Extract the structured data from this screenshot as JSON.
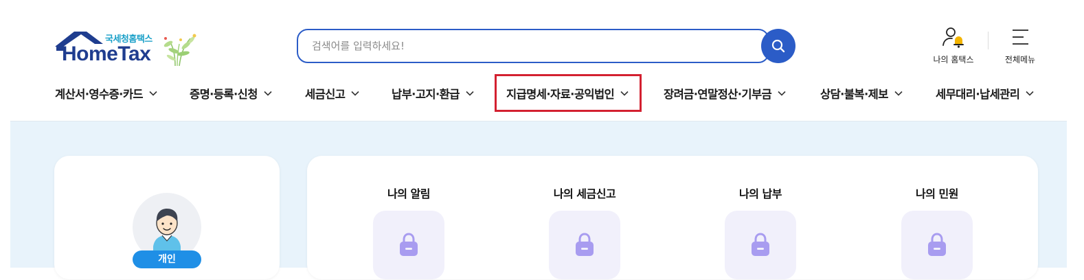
{
  "logo": {
    "sub": "국세청홈택스",
    "main": "HomeTax"
  },
  "search": {
    "placeholder": "검색어를 입력하세요!",
    "value": ""
  },
  "utils": {
    "my_hometax": "나의 홈택스",
    "all_menu": "전체메뉴"
  },
  "gnb": [
    {
      "label": "계산서·영수증·카드"
    },
    {
      "label": "증명·등록·신청"
    },
    {
      "label": "세금신고"
    },
    {
      "label": "납부·고지·환급"
    },
    {
      "label": "지급명세·자료·공익법인"
    },
    {
      "label": "장려금·연말정산·기부금"
    },
    {
      "label": "상담·불복·제보"
    },
    {
      "label": "세무대리·납세관리"
    }
  ],
  "profile": {
    "user_type": "개인"
  },
  "my_services": [
    {
      "title": "나의 알림",
      "icon": "lock-icon"
    },
    {
      "title": "나의 세금신고",
      "icon": "lock-icon"
    },
    {
      "title": "나의 납부",
      "icon": "lock-icon"
    },
    {
      "title": "나의 민원",
      "icon": "lock-icon"
    }
  ],
  "colors": {
    "primary": "#2b5cc7",
    "highlight": "#d32030",
    "background": "#e8f3fb",
    "badge": "#1f8fe6",
    "lock": "#a89cf0"
  }
}
